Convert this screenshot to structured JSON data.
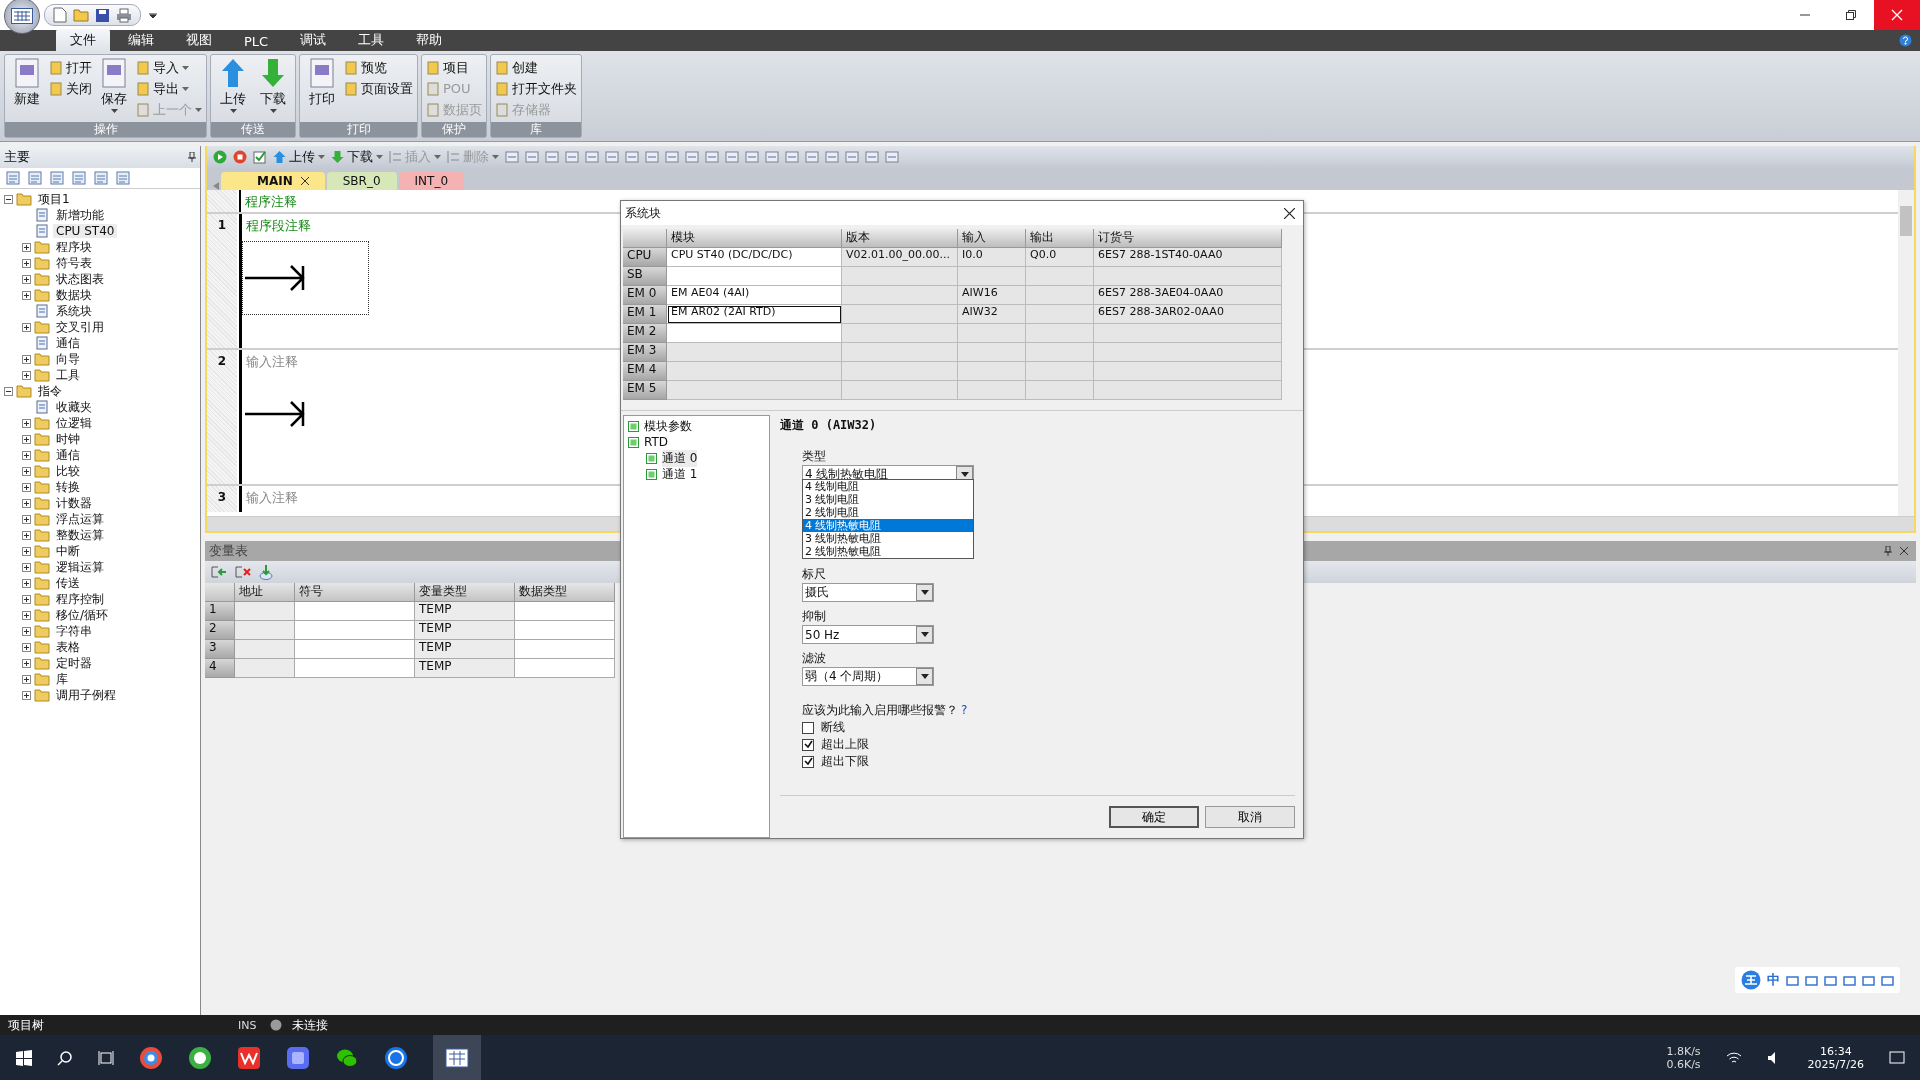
{
  "menu_tabs": [
    {
      "label": "文件",
      "selected": true
    },
    {
      "label": "编辑",
      "selected": false
    },
    {
      "label": "视图",
      "selected": false
    },
    {
      "label": "PLC",
      "selected": false
    },
    {
      "label": "调试",
      "selected": false
    },
    {
      "label": "工具",
      "selected": false
    },
    {
      "label": "帮助",
      "selected": false
    }
  ],
  "ribbon_groups": [
    {
      "title": "操作",
      "columns": [
        [
          {
            "label": "新建",
            "kind": "large",
            "disabled": false,
            "menu": false
          }
        ],
        [
          {
            "label": "打开",
            "kind": "small",
            "disabled": false,
            "menu": false
          },
          {
            "label": "关闭",
            "kind": "small",
            "disabled": false,
            "menu": false
          }
        ],
        [
          {
            "label": "保存",
            "kind": "large",
            "disabled": false,
            "menu": true
          }
        ],
        [
          {
            "label": "导入",
            "kind": "small",
            "disabled": false,
            "menu": true
          },
          {
            "label": "导出",
            "kind": "small",
            "disabled": false,
            "menu": true
          },
          {
            "label": "上一个",
            "kind": "small",
            "disabled": true,
            "menu": true
          }
        ]
      ]
    },
    {
      "title": "传送",
      "columns": [
        [
          {
            "label": "上传",
            "kind": "large",
            "disabled": false,
            "menu": true
          }
        ],
        [
          {
            "label": "下载",
            "kind": "large",
            "disabled": false,
            "menu": true
          }
        ]
      ]
    },
    {
      "title": "打印",
      "columns": [
        [
          {
            "label": "打印",
            "kind": "large",
            "disabled": false,
            "menu": false
          }
        ],
        [
          {
            "label": "预览",
            "kind": "small",
            "disabled": false,
            "menu": false
          },
          {
            "label": "页面设置",
            "kind": "small",
            "disabled": false,
            "menu": false
          }
        ]
      ]
    },
    {
      "title": "保护",
      "columns": [
        [
          {
            "label": "项目",
            "kind": "small",
            "disabled": false,
            "menu": false
          },
          {
            "label": "POU",
            "kind": "small",
            "disabled": true,
            "menu": false
          },
          {
            "label": "数据页",
            "kind": "small",
            "disabled": true,
            "menu": false
          }
        ]
      ]
    },
    {
      "title": "库",
      "columns": [
        [
          {
            "label": "创建",
            "kind": "small",
            "disabled": false,
            "menu": false
          },
          {
            "label": "打开文件夹",
            "kind": "small",
            "disabled": false,
            "menu": false
          },
          {
            "label": "存储器",
            "kind": "small",
            "disabled": true,
            "menu": false
          }
        ]
      ]
    }
  ],
  "sidebar": {
    "title": "主要",
    "tree": [
      {
        "label": "项目1",
        "kind": "folder",
        "expanded": true,
        "selected": false,
        "children": [
          {
            "label": "新增功能",
            "kind": "leaf",
            "selected": false
          },
          {
            "label": "CPU ST40",
            "kind": "leaf",
            "selected": true
          },
          {
            "label": "程序块",
            "kind": "folder",
            "expanded": false,
            "selected": false
          },
          {
            "label": "符号表",
            "kind": "folder",
            "expanded": false,
            "selected": false
          },
          {
            "label": "状态图表",
            "kind": "folder",
            "expanded": false,
            "selected": false
          },
          {
            "label": "数据块",
            "kind": "folder",
            "expanded": false,
            "selected": false
          },
          {
            "label": "系统块",
            "kind": "leaf",
            "selected": false
          },
          {
            "label": "交叉引用",
            "kind": "folder",
            "expanded": false,
            "selected": false
          },
          {
            "label": "通信",
            "kind": "leaf",
            "selected": false
          },
          {
            "label": "向导",
            "kind": "folder",
            "expanded": false,
            "selected": false
          },
          {
            "label": "工具",
            "kind": "folder",
            "expanded": false,
            "selected": false
          }
        ]
      },
      {
        "label": "指令",
        "kind": "folder",
        "expanded": true,
        "selected": false,
        "children": [
          {
            "label": "收藏夹",
            "kind": "leaf",
            "selected": false
          },
          {
            "label": "位逻辑",
            "kind": "folder",
            "expanded": false,
            "selected": false
          },
          {
            "label": "时钟",
            "kind": "folder",
            "expanded": false,
            "selected": false
          },
          {
            "label": "通信",
            "kind": "folder",
            "expanded": false,
            "selected": false
          },
          {
            "label": "比较",
            "kind": "folder",
            "expanded": false,
            "selected": false
          },
          {
            "label": "转换",
            "kind": "folder",
            "expanded": false,
            "selected": false
          },
          {
            "label": "计数器",
            "kind": "folder",
            "expanded": false,
            "selected": false
          },
          {
            "label": "浮点运算",
            "kind": "folder",
            "expanded": false,
            "selected": false
          },
          {
            "label": "整数运算",
            "kind": "folder",
            "expanded": false,
            "selected": false
          },
          {
            "label": "中断",
            "kind": "folder",
            "expanded": false,
            "selected": false
          },
          {
            "label": "逻辑运算",
            "kind": "folder",
            "expanded": false,
            "selected": false
          },
          {
            "label": "传送",
            "kind": "folder",
            "expanded": false,
            "selected": false
          },
          {
            "label": "程序控制",
            "kind": "folder",
            "expanded": false,
            "selected": false
          },
          {
            "label": "移位/循环",
            "kind": "folder",
            "expanded": false,
            "selected": false
          },
          {
            "label": "字符串",
            "kind": "folder",
            "expanded": false,
            "selected": false
          },
          {
            "label": "表格",
            "kind": "folder",
            "expanded": false,
            "selected": false
          },
          {
            "label": "定时器",
            "kind": "folder",
            "expanded": false,
            "selected": false
          },
          {
            "label": "库",
            "kind": "folder",
            "expanded": false,
            "selected": false
          },
          {
            "label": "调用子例程",
            "kind": "folder",
            "expanded": false,
            "selected": false
          }
        ]
      }
    ]
  },
  "editor": {
    "toolbar": [
      {
        "label": "上传",
        "disabled": false
      },
      {
        "label": "下载",
        "disabled": false
      },
      {
        "label": "插入",
        "disabled": true
      },
      {
        "label": "删除",
        "disabled": true
      }
    ],
    "tabs": [
      {
        "label": "MAIN",
        "selected": true,
        "color": "#fbe68a"
      },
      {
        "label": "SBR_0",
        "selected": false,
        "color": "#d6e8b8"
      },
      {
        "label": "INT_0",
        "selected": false,
        "color": "#f4b2b2"
      }
    ],
    "program_comment": "程序注释",
    "networks": [
      {
        "number": "1",
        "comment": "程序段注释",
        "kind": "comment"
      },
      {
        "number": "2",
        "comment": "输入注释",
        "kind": "placeholder"
      },
      {
        "number": "3",
        "comment": "输入注释",
        "kind": "placeholder"
      }
    ]
  },
  "variable_table": {
    "title": "变量表",
    "columns": [
      "地址",
      "符号",
      "变量类型",
      "数据类型"
    ],
    "rows": [
      {
        "number": "1",
        "var_type": "TEMP"
      },
      {
        "number": "2",
        "var_type": "TEMP"
      },
      {
        "number": "3",
        "var_type": "TEMP"
      },
      {
        "number": "4",
        "var_type": "TEMP"
      }
    ]
  },
  "dialog": {
    "title": "系统块",
    "columns": [
      "模块",
      "版本",
      "输入",
      "输出",
      "订货号"
    ],
    "rows": [
      {
        "slot": "CPU",
        "module": "CPU ST40 (DC/DC/DC)",
        "version": "V02.01.00_00.00...",
        "input": "I0.0",
        "output": "Q0.0",
        "order_number": "6ES7 288-1ST40-0AA0",
        "selected": false,
        "disabled": false
      },
      {
        "slot": "SB",
        "selected": false,
        "disabled": false
      },
      {
        "slot": "EM 0",
        "module": "EM AE04 (4AI)",
        "input": "AIW16",
        "order_number": "6ES7 288-3AE04-0AA0",
        "selected": false,
        "disabled": false
      },
      {
        "slot": "EM 1",
        "module": "EM AR02 (2AI RTD)",
        "input": "AIW32",
        "order_number": "6ES7 288-3AR02-0AA0",
        "selected": true,
        "disabled": false
      },
      {
        "slot": "EM 2",
        "selected": false,
        "disabled": false
      },
      {
        "slot": "EM 3",
        "selected": false,
        "disabled": true
      },
      {
        "slot": "EM 4",
        "selected": false,
        "disabled": true
      },
      {
        "slot": "EM 5",
        "selected": false,
        "disabled": true
      }
    ],
    "nav": [
      {
        "label": "模块参数",
        "selected": false
      },
      {
        "label": "RTD",
        "selected": false,
        "children": [
          {
            "label": "通道 0",
            "selected": true
          },
          {
            "label": "通道 1",
            "selected": false
          }
        ]
      }
    ],
    "heading": "通道 0 (AIW32)",
    "type_field": {
      "label": "类型",
      "value": "4 线制热敏电阻",
      "expanded": true,
      "options": [
        {
          "label": "4 线制电阻",
          "selected": false
        },
        {
          "label": "3 线制电阻",
          "selected": false
        },
        {
          "label": "2 线制电阻",
          "selected": false
        },
        {
          "label": "4 线制热敏电阻",
          "selected": true
        },
        {
          "label": "3 线制热敏电阻",
          "selected": false
        },
        {
          "label": "2 线制热敏电阻",
          "selected": false
        }
      ]
    },
    "fields": [
      {
        "label": "标尺",
        "value": "摄氏"
      },
      {
        "label": "抑制",
        "value": "50 Hz"
      },
      {
        "label": "滤波",
        "value": "弱（4 个周期）"
      }
    ],
    "alarm_question": "应该为此输入启用哪些报警？",
    "help": "?",
    "alarms": [
      {
        "label": "断线",
        "checked": false
      },
      {
        "label": "超出上限",
        "checked": true
      },
      {
        "label": "超出下限",
        "checked": true
      }
    ],
    "buttons": [
      {
        "label": "确定",
        "kind": "default"
      },
      {
        "label": "取消",
        "kind": "normal"
      }
    ]
  },
  "ime_toolbar": {
    "mode": "中"
  },
  "status_bar": {
    "panel": "项目树",
    "mode": "INS",
    "connection": "未连接"
  },
  "taskbar": {
    "upload_speed": "1.8K/s",
    "download_speed": "0.6K/s",
    "time": "16:34",
    "date": "2025/7/26"
  }
}
